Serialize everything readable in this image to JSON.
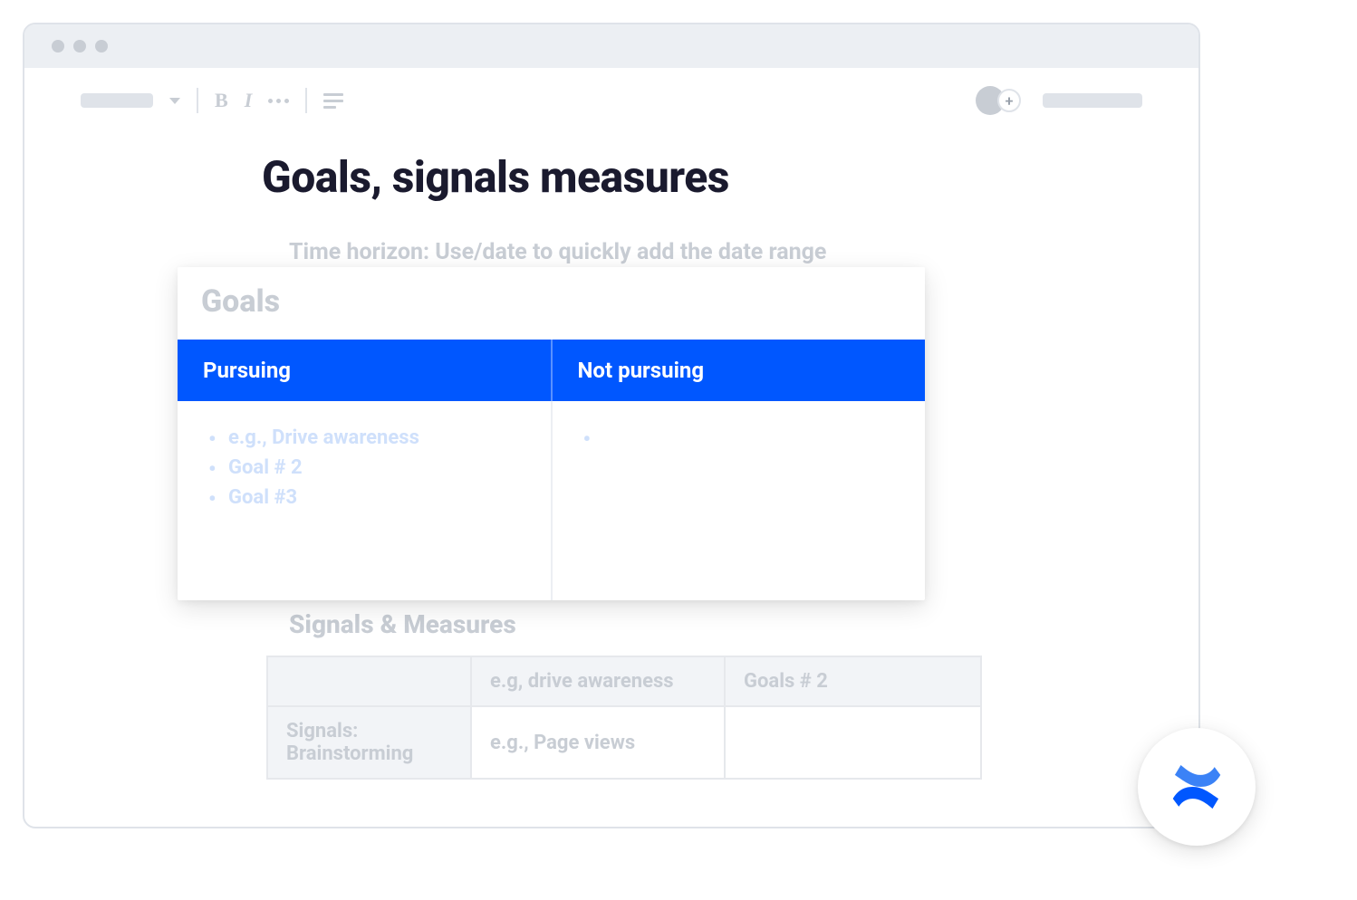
{
  "toolbar": {
    "bold_label": "B",
    "italic_label": "I"
  },
  "avatar": {
    "add_label": "+"
  },
  "document": {
    "title": "Goals, signals measures",
    "subtitle": "Time horizon: Use/date to quickly add the date range"
  },
  "goals_panel": {
    "title": "Goals",
    "columns": {
      "pursuing": "Pursuing",
      "not_pursuing": "Not pursuing"
    },
    "pursuing_items": [
      "e.g., Drive awareness",
      "Goal # 2",
      "Goal #3"
    ],
    "not_pursuing_items": [
      ""
    ]
  },
  "signals": {
    "heading": "Signals & Measures",
    "header_blank": "",
    "header_col1": "e.g, drive awareness",
    "header_col2": "Goals # 2",
    "row1_label": "Signals: Brainstorming",
    "row1_col1": "e.g., Page views",
    "row1_col2": ""
  }
}
